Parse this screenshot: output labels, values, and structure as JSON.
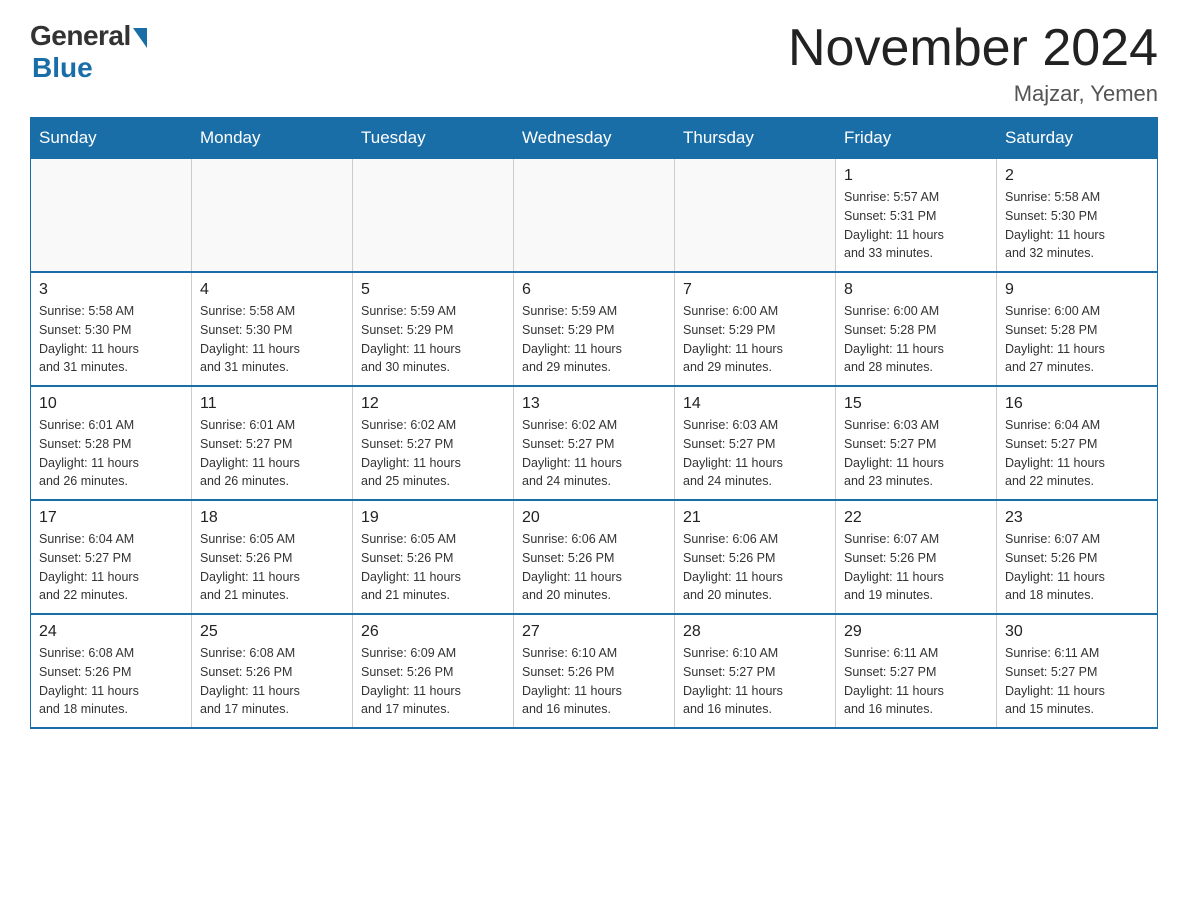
{
  "header": {
    "logo_general": "General",
    "logo_blue": "Blue",
    "title": "November 2024",
    "location": "Majzar, Yemen"
  },
  "calendar": {
    "days_of_week": [
      "Sunday",
      "Monday",
      "Tuesday",
      "Wednesday",
      "Thursday",
      "Friday",
      "Saturday"
    ],
    "weeks": [
      {
        "days": [
          {
            "number": "",
            "info": ""
          },
          {
            "number": "",
            "info": ""
          },
          {
            "number": "",
            "info": ""
          },
          {
            "number": "",
            "info": ""
          },
          {
            "number": "",
            "info": ""
          },
          {
            "number": "1",
            "info": "Sunrise: 5:57 AM\nSunset: 5:31 PM\nDaylight: 11 hours\nand 33 minutes."
          },
          {
            "number": "2",
            "info": "Sunrise: 5:58 AM\nSunset: 5:30 PM\nDaylight: 11 hours\nand 32 minutes."
          }
        ]
      },
      {
        "days": [
          {
            "number": "3",
            "info": "Sunrise: 5:58 AM\nSunset: 5:30 PM\nDaylight: 11 hours\nand 31 minutes."
          },
          {
            "number": "4",
            "info": "Sunrise: 5:58 AM\nSunset: 5:30 PM\nDaylight: 11 hours\nand 31 minutes."
          },
          {
            "number": "5",
            "info": "Sunrise: 5:59 AM\nSunset: 5:29 PM\nDaylight: 11 hours\nand 30 minutes."
          },
          {
            "number": "6",
            "info": "Sunrise: 5:59 AM\nSunset: 5:29 PM\nDaylight: 11 hours\nand 29 minutes."
          },
          {
            "number": "7",
            "info": "Sunrise: 6:00 AM\nSunset: 5:29 PM\nDaylight: 11 hours\nand 29 minutes."
          },
          {
            "number": "8",
            "info": "Sunrise: 6:00 AM\nSunset: 5:28 PM\nDaylight: 11 hours\nand 28 minutes."
          },
          {
            "number": "9",
            "info": "Sunrise: 6:00 AM\nSunset: 5:28 PM\nDaylight: 11 hours\nand 27 minutes."
          }
        ]
      },
      {
        "days": [
          {
            "number": "10",
            "info": "Sunrise: 6:01 AM\nSunset: 5:28 PM\nDaylight: 11 hours\nand 26 minutes."
          },
          {
            "number": "11",
            "info": "Sunrise: 6:01 AM\nSunset: 5:27 PM\nDaylight: 11 hours\nand 26 minutes."
          },
          {
            "number": "12",
            "info": "Sunrise: 6:02 AM\nSunset: 5:27 PM\nDaylight: 11 hours\nand 25 minutes."
          },
          {
            "number": "13",
            "info": "Sunrise: 6:02 AM\nSunset: 5:27 PM\nDaylight: 11 hours\nand 24 minutes."
          },
          {
            "number": "14",
            "info": "Sunrise: 6:03 AM\nSunset: 5:27 PM\nDaylight: 11 hours\nand 24 minutes."
          },
          {
            "number": "15",
            "info": "Sunrise: 6:03 AM\nSunset: 5:27 PM\nDaylight: 11 hours\nand 23 minutes."
          },
          {
            "number": "16",
            "info": "Sunrise: 6:04 AM\nSunset: 5:27 PM\nDaylight: 11 hours\nand 22 minutes."
          }
        ]
      },
      {
        "days": [
          {
            "number": "17",
            "info": "Sunrise: 6:04 AM\nSunset: 5:27 PM\nDaylight: 11 hours\nand 22 minutes."
          },
          {
            "number": "18",
            "info": "Sunrise: 6:05 AM\nSunset: 5:26 PM\nDaylight: 11 hours\nand 21 minutes."
          },
          {
            "number": "19",
            "info": "Sunrise: 6:05 AM\nSunset: 5:26 PM\nDaylight: 11 hours\nand 21 minutes."
          },
          {
            "number": "20",
            "info": "Sunrise: 6:06 AM\nSunset: 5:26 PM\nDaylight: 11 hours\nand 20 minutes."
          },
          {
            "number": "21",
            "info": "Sunrise: 6:06 AM\nSunset: 5:26 PM\nDaylight: 11 hours\nand 20 minutes."
          },
          {
            "number": "22",
            "info": "Sunrise: 6:07 AM\nSunset: 5:26 PM\nDaylight: 11 hours\nand 19 minutes."
          },
          {
            "number": "23",
            "info": "Sunrise: 6:07 AM\nSunset: 5:26 PM\nDaylight: 11 hours\nand 18 minutes."
          }
        ]
      },
      {
        "days": [
          {
            "number": "24",
            "info": "Sunrise: 6:08 AM\nSunset: 5:26 PM\nDaylight: 11 hours\nand 18 minutes."
          },
          {
            "number": "25",
            "info": "Sunrise: 6:08 AM\nSunset: 5:26 PM\nDaylight: 11 hours\nand 17 minutes."
          },
          {
            "number": "26",
            "info": "Sunrise: 6:09 AM\nSunset: 5:26 PM\nDaylight: 11 hours\nand 17 minutes."
          },
          {
            "number": "27",
            "info": "Sunrise: 6:10 AM\nSunset: 5:26 PM\nDaylight: 11 hours\nand 16 minutes."
          },
          {
            "number": "28",
            "info": "Sunrise: 6:10 AM\nSunset: 5:27 PM\nDaylight: 11 hours\nand 16 minutes."
          },
          {
            "number": "29",
            "info": "Sunrise: 6:11 AM\nSunset: 5:27 PM\nDaylight: 11 hours\nand 16 minutes."
          },
          {
            "number": "30",
            "info": "Sunrise: 6:11 AM\nSunset: 5:27 PM\nDaylight: 11 hours\nand 15 minutes."
          }
        ]
      }
    ]
  }
}
